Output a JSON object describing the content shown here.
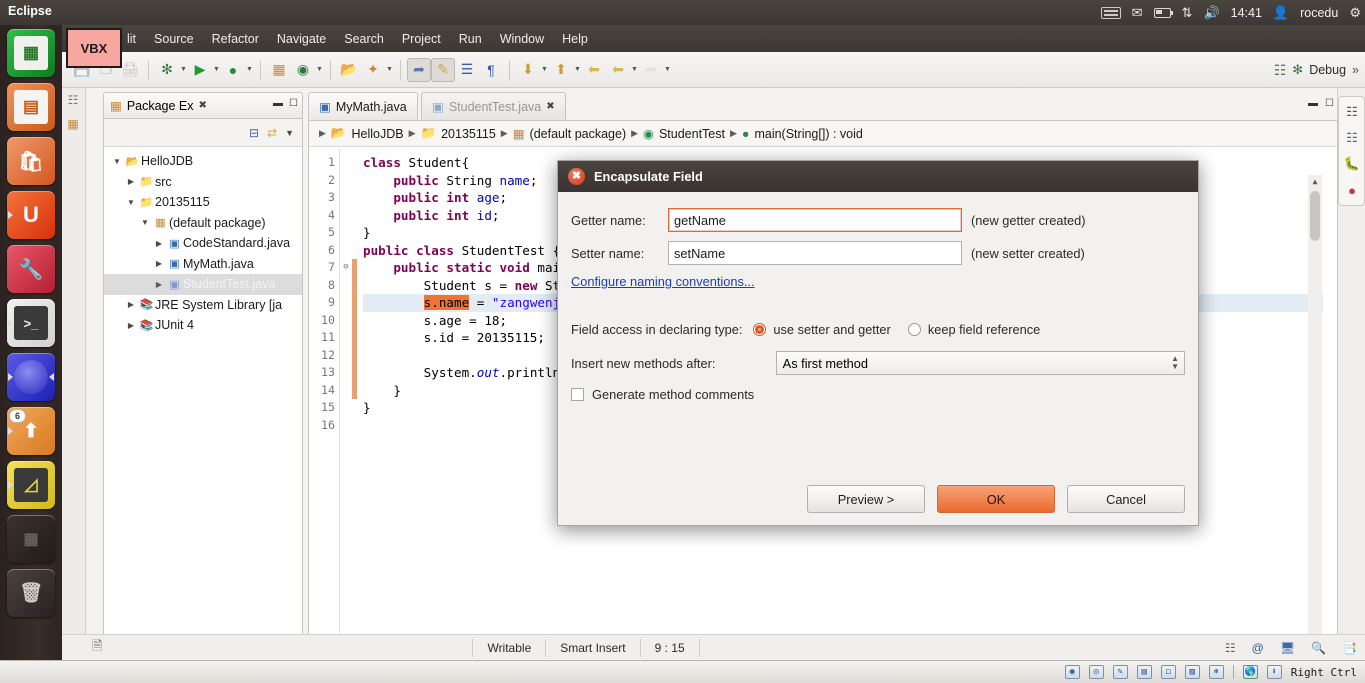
{
  "top_panel": {
    "title": "Eclipse",
    "tray": {
      "keyboard_icon": "keyboard-icon",
      "mail_icon": "envelope-icon",
      "battery_icon": "battery-icon",
      "network_icon": "network-updown-icon",
      "volume_icon": "volume-icon",
      "clock": "14:41",
      "user": "rocedu",
      "power_icon": "power-gear-icon"
    }
  },
  "launcher": {
    "items": [
      {
        "name": "libreoffice-calc",
        "glyph": "▦",
        "color": "#1aa33a",
        "badge": null
      },
      {
        "name": "libreoffice-impress",
        "glyph": "▤",
        "color": "#e06a2a",
        "badge": null
      },
      {
        "name": "ubuntu-software-center",
        "glyph": "🛍",
        "color": "#dd6a35",
        "badge": null
      },
      {
        "name": "ubuntu-one",
        "glyph": "U",
        "color": "#e8491a",
        "badge": null
      },
      {
        "name": "system-settings",
        "glyph": "⚙",
        "color": "#d8334a",
        "badge": null
      },
      {
        "name": "terminal",
        "glyph": "▶_",
        "color": "#3a3a3a",
        "badge": null
      },
      {
        "name": "eclipse",
        "glyph": "◉",
        "color": "#3a3ad8",
        "badge": null
      },
      {
        "name": "file-uploader",
        "glyph": "⬆",
        "color": "#e08a3a",
        "badge": "6"
      },
      {
        "name": "display-settings",
        "glyph": "◺",
        "color": "#e8d13a",
        "badge": null
      },
      {
        "name": "workspace-switcher",
        "glyph": "▦",
        "color": "#2a2422",
        "badge": null
      },
      {
        "name": "trash",
        "glyph": "🗑",
        "color": "#3a3330",
        "badge": null
      }
    ]
  },
  "vbx_sticker": {
    "label": "VBX"
  },
  "menubar": {
    "items": [
      "lit",
      "Source",
      "Refactor",
      "Navigate",
      "Search",
      "Project",
      "Run",
      "Window",
      "Help"
    ]
  },
  "toolbar": {
    "groups": [
      [
        "save-icon",
        "save-all-icon",
        "print-icon"
      ],
      [
        "debug-icon",
        "run-icon",
        "run-external-tools-icon"
      ],
      [
        "new-java-project-icon",
        "new-java-class-icon"
      ],
      [
        "open-type-icon",
        "search-icon"
      ],
      [
        "toggle-mark-occurrences-icon",
        "toggle-annotation-icon",
        "show-whitespace-icon",
        "pilcrow-icon"
      ],
      [
        "next-annotation-icon",
        "previous-annotation-icon",
        "last-edit-location-icon",
        "back-icon",
        "forward-icon"
      ]
    ],
    "perspective": {
      "open_perspective_icon": "open-perspective-icon",
      "debug_icon": "debug-perspective-icon",
      "debug_label": "Debug",
      "overflow": "»"
    }
  },
  "package_explorer": {
    "tab_label": "Package Ex",
    "tab_icon": "package-explorer-icon",
    "close_icon": "close-icon",
    "minimize_icon": "minimize-icon",
    "maximize_icon": "maximize-icon",
    "tools": [
      "collapse-all-icon",
      "link-with-editor-icon",
      "view-menu-icon"
    ],
    "tree": [
      {
        "label": "HelloJDB",
        "indent": 0,
        "arrow": "▼",
        "icon": "java-project-icon",
        "selected": false
      },
      {
        "label": "src",
        "indent": 1,
        "arrow": "▶",
        "icon": "source-folder-icon",
        "selected": false
      },
      {
        "label": "20135115",
        "indent": 1,
        "arrow": "▼",
        "icon": "source-folder-icon",
        "selected": false
      },
      {
        "label": "(default package)",
        "indent": 2,
        "arrow": "▼",
        "icon": "package-icon",
        "selected": false
      },
      {
        "label": "CodeStandard.java",
        "indent": 3,
        "arrow": "▶",
        "icon": "java-file-icon",
        "selected": false
      },
      {
        "label": "MyMath.java",
        "indent": 3,
        "arrow": "▶",
        "icon": "java-file-icon",
        "selected": false
      },
      {
        "label": "StudentTest.java",
        "indent": 3,
        "arrow": "▶",
        "icon": "java-file-icon",
        "selected": true
      },
      {
        "label": "JRE System Library [ja",
        "indent": 1,
        "arrow": "▶",
        "icon": "library-icon",
        "selected": false
      },
      {
        "label": "JUnit 4",
        "indent": 1,
        "arrow": "▶",
        "icon": "library-icon",
        "selected": false
      }
    ]
  },
  "editor": {
    "tabs": [
      {
        "label": "MyMath.java",
        "icon": "java-file-icon",
        "active": false,
        "closable": false
      },
      {
        "label": "StudentTest.java",
        "icon": "java-file-icon",
        "active": true,
        "closable": true
      }
    ],
    "tab_controls": [
      "minimize-icon",
      "maximize-icon"
    ],
    "breadcrumb": [
      {
        "label": "HelloJDB",
        "icon": "java-project-icon"
      },
      {
        "label": "20135115",
        "icon": "source-folder-icon"
      },
      {
        "label": "(default package)",
        "icon": "package-icon"
      },
      {
        "label": "StudentTest",
        "icon": "class-icon"
      },
      {
        "label": "main(String[]) : void",
        "icon": "method-icon"
      }
    ],
    "line_numbers": [
      1,
      2,
      3,
      4,
      5,
      6,
      7,
      8,
      9,
      10,
      11,
      12,
      13,
      14,
      15,
      16
    ],
    "fold_markers": {
      "7": "⊖"
    },
    "current_line": 9,
    "code_lines": [
      {
        "n": 1,
        "segments": [
          {
            "t": "class ",
            "c": "k"
          },
          {
            "t": "Student{",
            "c": ""
          }
        ]
      },
      {
        "n": 2,
        "segments": [
          {
            "t": "    public ",
            "c": "k"
          },
          {
            "t": "String ",
            "c": ""
          },
          {
            "t": "name",
            "c": "f-"
          },
          {
            "t": ";",
            "c": ""
          }
        ]
      },
      {
        "n": 3,
        "segments": [
          {
            "t": "    public int ",
            "c": "k"
          },
          {
            "t": "age",
            "c": "f-"
          },
          {
            "t": ";",
            "c": ""
          }
        ]
      },
      {
        "n": 4,
        "segments": [
          {
            "t": "    public int ",
            "c": "k"
          },
          {
            "t": "id",
            "c": "f-"
          },
          {
            "t": ";",
            "c": ""
          }
        ]
      },
      {
        "n": 5,
        "segments": [
          {
            "t": "}",
            "c": ""
          }
        ]
      },
      {
        "n": 6,
        "segments": [
          {
            "t": "public class ",
            "c": "k"
          },
          {
            "t": "StudentTest {",
            "c": ""
          }
        ]
      },
      {
        "n": 7,
        "segments": [
          {
            "t": "    public static void ",
            "c": "k"
          },
          {
            "t": "mai",
            "c": ""
          }
        ]
      },
      {
        "n": 8,
        "segments": [
          {
            "t": "        Student s = ",
            "c": ""
          },
          {
            "t": "new ",
            "c": "k"
          },
          {
            "t": "St",
            "c": ""
          }
        ]
      },
      {
        "n": 9,
        "segments": [
          {
            "t": "        ",
            "c": ""
          },
          {
            "t": "s.name",
            "c": "hl"
          },
          {
            "t": " = ",
            "c": ""
          },
          {
            "t": "\"zangwenj",
            "c": "s"
          }
        ]
      },
      {
        "n": 10,
        "segments": [
          {
            "t": "        s.age = 18;",
            "c": ""
          }
        ]
      },
      {
        "n": 11,
        "segments": [
          {
            "t": "        s.id = 20135115;",
            "c": ""
          }
        ]
      },
      {
        "n": 12,
        "segments": [
          {
            "t": "",
            "c": ""
          }
        ]
      },
      {
        "n": 13,
        "segments": [
          {
            "t": "        System.",
            "c": ""
          },
          {
            "t": "out",
            "c": "it"
          },
          {
            "t": ".println",
            "c": ""
          }
        ]
      },
      {
        "n": 14,
        "segments": [
          {
            "t": "    }",
            "c": ""
          }
        ]
      },
      {
        "n": 15,
        "segments": [
          {
            "t": "}",
            "c": ""
          }
        ]
      },
      {
        "n": 16,
        "segments": [
          {
            "t": "",
            "c": ""
          }
        ]
      }
    ]
  },
  "dialog": {
    "title": "Encapsulate Field",
    "close_icon": "close-icon",
    "getter_label": "Getter name:",
    "getter_value": "getName",
    "getter_note": "(new getter created)",
    "setter_label": "Setter name:",
    "setter_value": "setName",
    "setter_note": "(new setter created)",
    "configure_link": "Configure naming conventions...",
    "field_access_label": "Field access in declaring type:",
    "radio_use_setter_getter": "use setter and getter",
    "radio_keep_field_reference": "keep field reference",
    "radio_selected": "use setter and getter",
    "insert_after_label": "Insert new methods after:",
    "insert_after_value": "As first method",
    "generate_comments_label": "Generate method comments",
    "generate_comments_checked": false,
    "buttons": {
      "preview": "Preview >",
      "ok": "OK",
      "cancel": "Cancel",
      "default_button": "OK"
    },
    "accent_color": "#ec6a2e"
  },
  "status_bar": {
    "left_icon": "smart-insert-icon",
    "writable": "Writable",
    "insert_mode": "Smart Insert",
    "cursor_position": "9 : 15",
    "right_icons": [
      "restore-icon",
      "at-icon",
      "console-icon",
      "quick-access-icon",
      "search-doc-icon"
    ]
  },
  "vbox_bar": {
    "icons": [
      "hdd-icon",
      "cd-icon",
      "pencil-icon",
      "network-icon",
      "display-icon",
      "folder-share-icon",
      "usb-icon",
      "globe-icon",
      "capture-icon"
    ],
    "host_key": "Right Ctrl"
  }
}
